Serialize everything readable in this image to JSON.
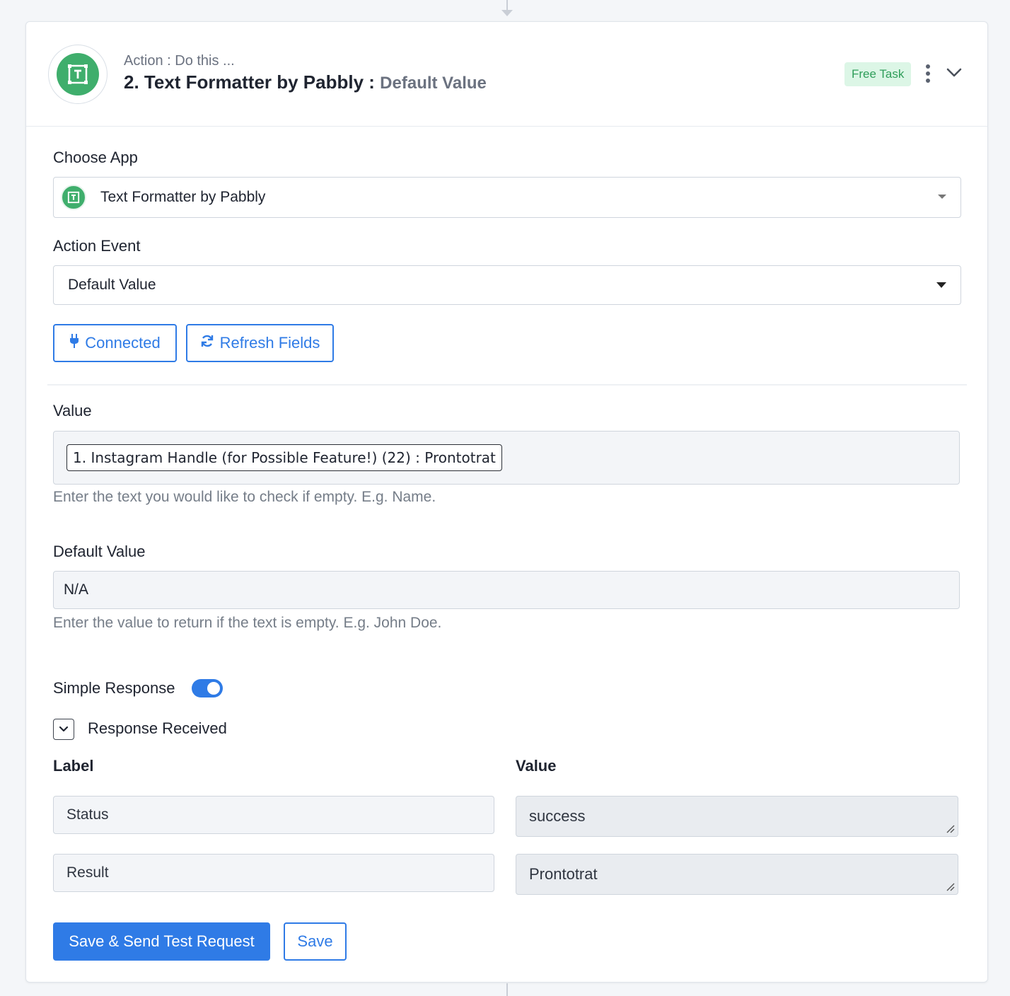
{
  "header": {
    "subtitle": "Action : Do this ...",
    "title": "2. Text Formatter by Pabbly :",
    "event": "Default Value",
    "badge": "Free Task",
    "logo_icon": "text-formatter-icon",
    "menu_icon": "kebab-menu-icon",
    "collapse_icon": "chevron-down-icon"
  },
  "choose_app": {
    "label": "Choose App",
    "value": "Text Formatter by Pabbly"
  },
  "action_event": {
    "label": "Action Event",
    "value": "Default Value"
  },
  "buttons": {
    "connected": "Connected",
    "refresh": "Refresh Fields",
    "save_send": "Save & Send Test Request",
    "save": "Save"
  },
  "value_field": {
    "label": "Value",
    "token": "1. Instagram Handle (for Possible Feature!) (22) : Prontotrat",
    "help": "Enter the text you would like to check if empty. E.g. Name."
  },
  "default_value_field": {
    "label": "Default Value",
    "value": "N/A",
    "help": "Enter the value to return if the text is empty. E.g. John Doe."
  },
  "simple_response": {
    "label": "Simple Response",
    "enabled": true
  },
  "response_received": {
    "label": "Response Received",
    "columns": {
      "label": "Label",
      "value": "Value"
    },
    "rows": [
      {
        "label": "Status",
        "value": "success"
      },
      {
        "label": "Result",
        "value": "Prontotrat"
      }
    ]
  },
  "colors": {
    "accent": "#2f7be6",
    "brand_green": "#3fae6c",
    "badge_bg": "#dcf6e6"
  }
}
